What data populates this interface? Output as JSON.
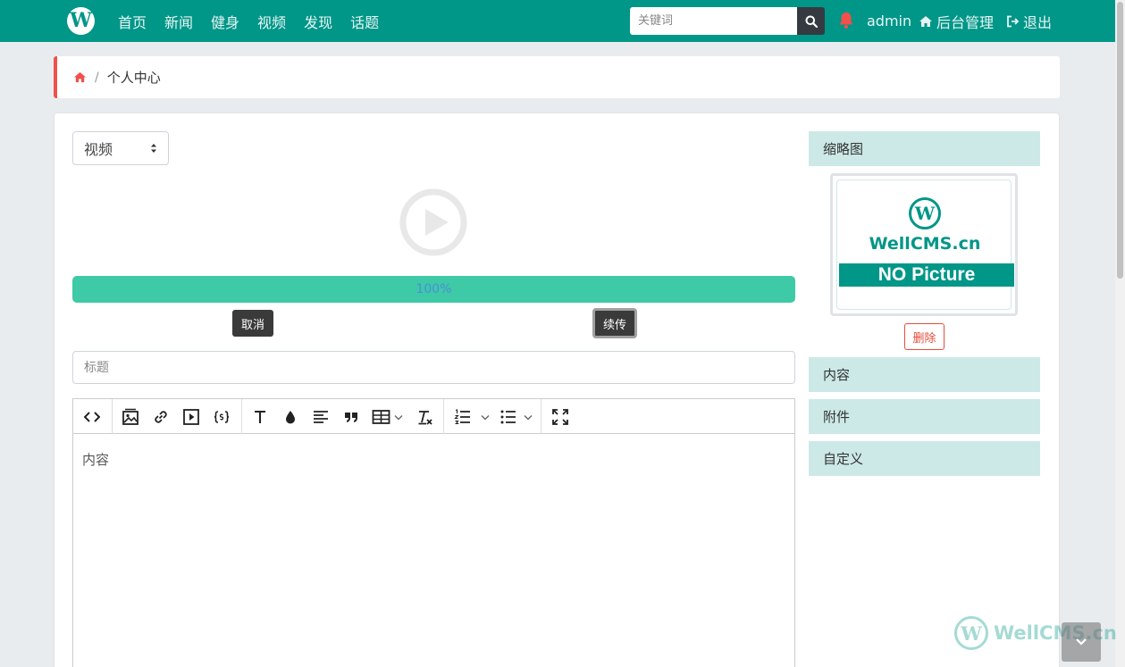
{
  "navbar": {
    "logo_letter": "W",
    "links": [
      "首页",
      "新闻",
      "健身",
      "视频",
      "发现",
      "话题"
    ],
    "search_placeholder": "关键词",
    "user": "admin",
    "admin_label": "后台管理",
    "logout_label": "退出",
    "color": "#009688"
  },
  "breadcrumb": {
    "current": "个人中心"
  },
  "form": {
    "type_selected": "视频",
    "upload_progress": "100%",
    "upload_progress_value": 100,
    "cancel_label": "取消",
    "resume_label": "续传",
    "title_placeholder": "标题",
    "editor_placeholder": "内容"
  },
  "panel": {
    "thumbnail_header": "缩略图",
    "thumb_logo_letter": "W",
    "thumb_brand": "WellCMS.cn",
    "thumb_label": "NO Picture",
    "delete_label": "删除",
    "content_header": "内容",
    "attachment_header": "附件",
    "custom_header": "自定义"
  },
  "watermark": {
    "letter": "W",
    "text": "WellCMS.cn"
  }
}
